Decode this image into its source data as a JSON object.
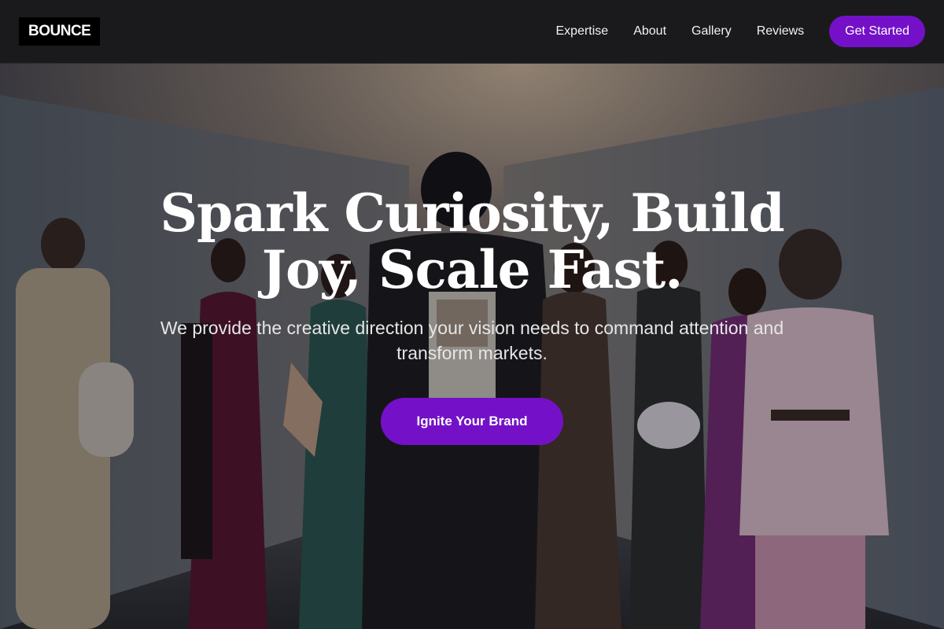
{
  "header": {
    "logo": "BOUNCE",
    "nav": [
      {
        "label": "Expertise"
      },
      {
        "label": "About"
      },
      {
        "label": "Gallery"
      },
      {
        "label": "Reviews"
      }
    ],
    "cta_label": "Get Started"
  },
  "hero": {
    "title": "Spark Curiosity, Build Joy, Scale Fast.",
    "subtitle": "We provide the creative direction your vision needs to command attention and transform markets.",
    "cta_label": "Ignite Your Brand",
    "background_image": "fashion-group-photo"
  },
  "colors": {
    "accent": "#7411c8",
    "header_bg": "#1a1a1c",
    "text": "#ffffff"
  }
}
